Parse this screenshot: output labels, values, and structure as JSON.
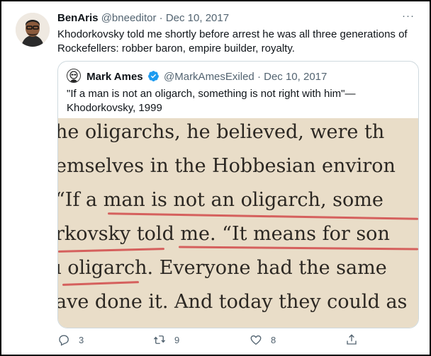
{
  "tweet": {
    "author_name": "BenAris",
    "author_handle": "@bneeditor",
    "separator": "·",
    "date": "Dec 10, 2017",
    "more_label": "···",
    "text": "Khodorkovsky told me shortly before arrest he was all three generations of Rockefellers: robber baron, empire builder, royalty."
  },
  "quoted": {
    "author_name": "Mark Ames",
    "author_handle": "@MarkAmesExiled",
    "separator": "·",
    "date": "Dec 10, 2017",
    "text": "\"If a man is not an oligarch, something is not right with him\"— Khodorkovsky, 1999",
    "image_lines": [
      "he oligarchs, he believed, were th",
      "emselves in the Hobbesian environ",
      " “If a man is not an oligarch, some",
      "rkovsky told me. “It means for son",
      "ı oligarch. Everyone had the same",
      "ave done it. And today they could as"
    ]
  },
  "actions": {
    "reply_count": "3",
    "retweet_count": "9",
    "like_count": "8"
  },
  "colors": {
    "text": "#0f1419",
    "secondary": "#536471",
    "border": "#cfd9de",
    "verified": "#1d9bf0",
    "underline": "#d14a4a"
  },
  "icons": [
    "more-icon",
    "verified-badge-icon",
    "reply-icon",
    "retweet-icon",
    "like-icon",
    "share-icon"
  ]
}
